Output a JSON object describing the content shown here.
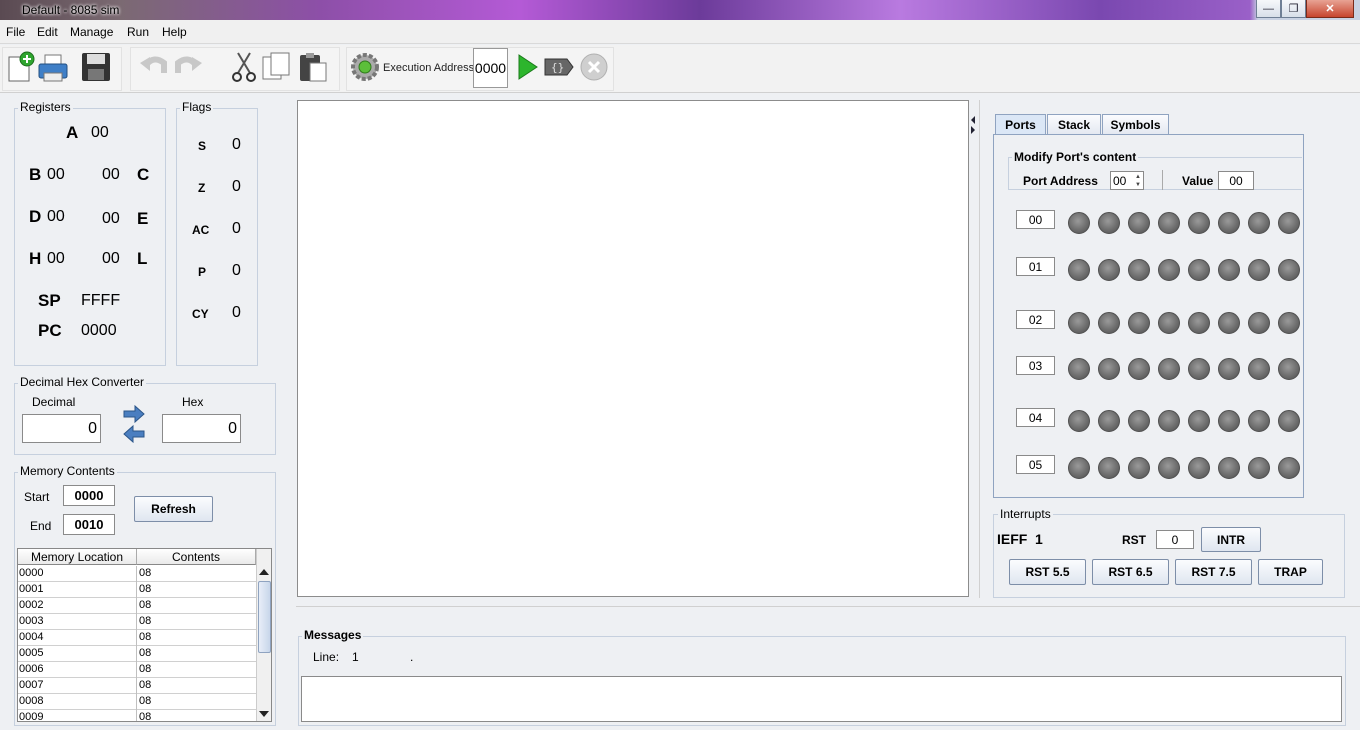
{
  "window": {
    "title": "Default - 8085 sim"
  },
  "menu": [
    "File",
    "Edit",
    "Manage",
    "Run",
    "Help"
  ],
  "toolbar": {
    "execution_address_label": "Execution Address:",
    "execution_address": "0000"
  },
  "registers": {
    "title": "Registers",
    "A": {
      "name": "A",
      "value": "00"
    },
    "B": {
      "name": "B",
      "value": "00"
    },
    "C": {
      "name": "C",
      "value": "00"
    },
    "D": {
      "name": "D",
      "value": "00"
    },
    "E": {
      "name": "E",
      "value": "00"
    },
    "H": {
      "name": "H",
      "value": "00"
    },
    "L": {
      "name": "L",
      "value": "00"
    },
    "SP": {
      "name": "SP",
      "value": "FFFF"
    },
    "PC": {
      "name": "PC",
      "value": "0000"
    }
  },
  "flags": {
    "title": "Flags",
    "items": [
      {
        "name": "S",
        "value": "0"
      },
      {
        "name": "Z",
        "value": "0"
      },
      {
        "name": "AC",
        "value": "0"
      },
      {
        "name": "P",
        "value": "0"
      },
      {
        "name": "CY",
        "value": "0"
      }
    ]
  },
  "converter": {
    "title": "Decimal Hex Converter",
    "decimal_label": "Decimal",
    "hex_label": "Hex",
    "decimal_value": "0",
    "hex_value": "0"
  },
  "memory": {
    "title": "Memory Contents",
    "start_label": "Start",
    "start": "0000",
    "end_label": "End",
    "end": "0010",
    "refresh_label": "Refresh",
    "columns": [
      "Memory Location",
      "Contents"
    ],
    "rows": [
      [
        "0000",
        "08"
      ],
      [
        "0001",
        "08"
      ],
      [
        "0002",
        "08"
      ],
      [
        "0003",
        "08"
      ],
      [
        "0004",
        "08"
      ],
      [
        "0005",
        "08"
      ],
      [
        "0006",
        "08"
      ],
      [
        "0007",
        "08"
      ],
      [
        "0008",
        "08"
      ],
      [
        "0009",
        "08"
      ]
    ]
  },
  "right_panel": {
    "tabs": [
      "Ports",
      "Stack",
      "Symbols"
    ],
    "active_tab": "Ports",
    "modify_title": "Modify Port's content",
    "port_address_label": "Port Address",
    "port_address": "00",
    "value_label": "Value",
    "value": "00",
    "ports": [
      "00",
      "01",
      "02",
      "03",
      "04",
      "05"
    ]
  },
  "interrupts": {
    "title": "Interrupts",
    "ieff_label": "IEFF",
    "ieff_value": "1",
    "rst_label": "RST",
    "rst_value": "0",
    "intr_label": "INTR",
    "buttons": [
      "RST 5.5",
      "RST 6.5",
      "RST 7.5",
      "TRAP"
    ]
  },
  "messages": {
    "title": "Messages",
    "line_label": "Line:",
    "line_value": "1",
    "status": "."
  }
}
